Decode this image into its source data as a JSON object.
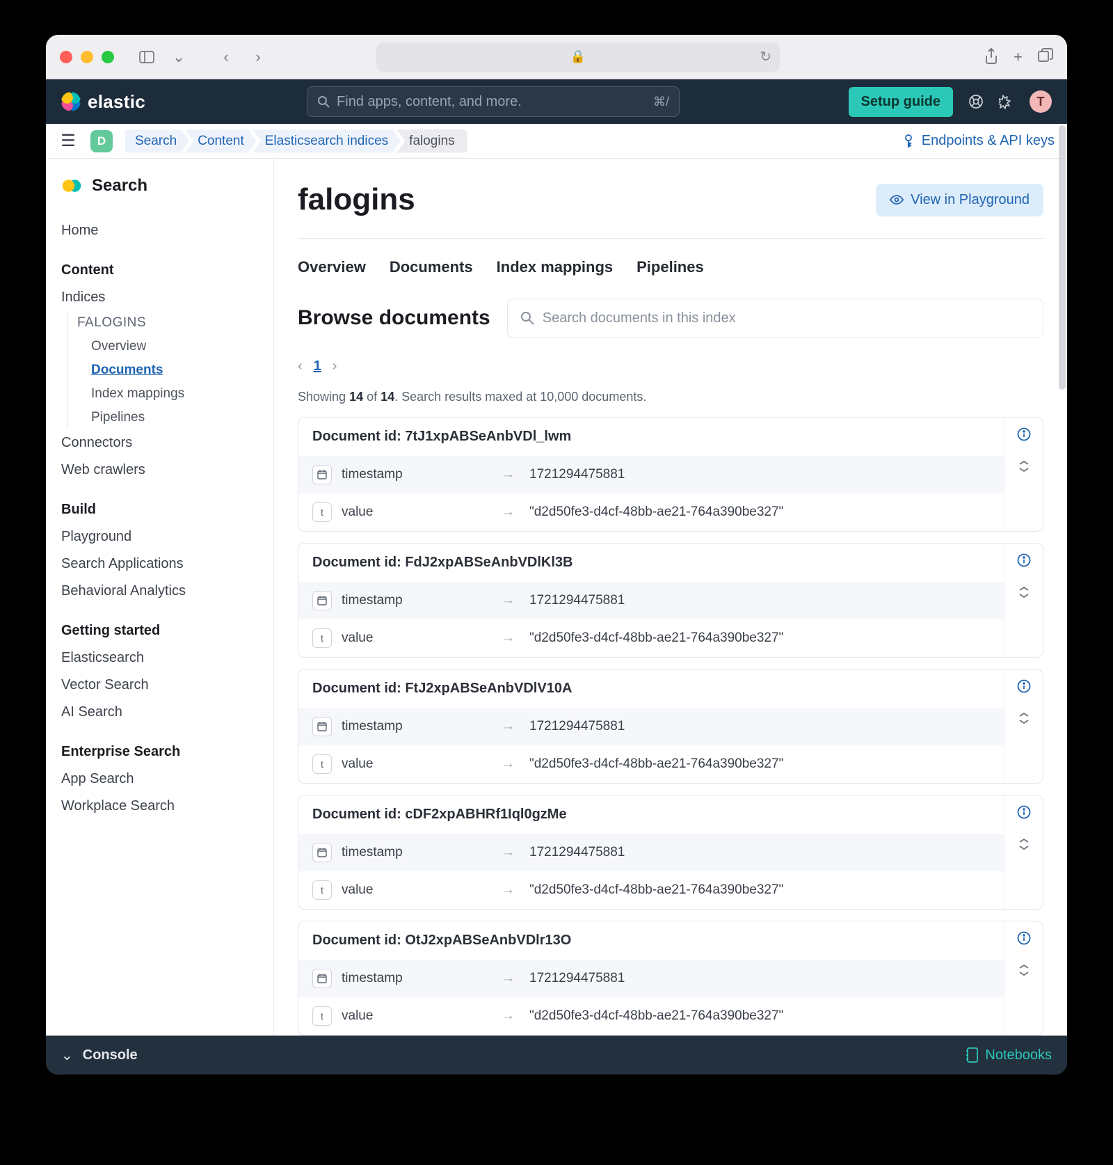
{
  "browser": {
    "lock": "🔒",
    "reload": "↻",
    "share": "⇧",
    "plus": "+",
    "tabs": "❐"
  },
  "header": {
    "brand": "elastic",
    "search_placeholder": "Find apps, content, and more.",
    "search_shortcut": "⌘/",
    "setup_guide": "Setup guide",
    "avatar_initial": "T"
  },
  "breadcrumb": {
    "space_initial": "D",
    "items": [
      "Search",
      "Content",
      "Elasticsearch indices",
      "falogins"
    ],
    "endpoints_link": "Endpoints & API keys"
  },
  "sidebar": {
    "section_title": "Search",
    "home": "Home",
    "content": {
      "head": "Content",
      "indices": "Indices",
      "current_index": "FALOGINS",
      "pages": [
        "Overview",
        "Documents",
        "Index mappings",
        "Pipelines"
      ],
      "selected": "Documents",
      "connectors": "Connectors",
      "web_crawlers": "Web crawlers"
    },
    "build": {
      "head": "Build",
      "items": [
        "Playground",
        "Search Applications",
        "Behavioral Analytics"
      ]
    },
    "getting_started": {
      "head": "Getting started",
      "items": [
        "Elasticsearch",
        "Vector Search",
        "AI Search"
      ]
    },
    "enterprise": {
      "head": "Enterprise Search",
      "items": [
        "App Search",
        "Workplace Search"
      ]
    }
  },
  "page": {
    "title": "falogins",
    "view_playground": "View in Playground",
    "tabs": [
      "Overview",
      "Documents",
      "Index mappings",
      "Pipelines"
    ],
    "browse_heading": "Browse documents",
    "doc_search_placeholder": "Search documents in this index",
    "pagination": {
      "current": "1"
    },
    "showing": {
      "prefix": "Showing ",
      "count": "14",
      "of_word": " of ",
      "total": "14",
      "suffix": ". Search results maxed at 10,000 documents."
    }
  },
  "documents": [
    {
      "id_label": "Document id: 7tJ1xpABSeAnbVDl_lwm",
      "fields": [
        {
          "type": "date",
          "name": "timestamp",
          "value": "1721294475881"
        },
        {
          "type": "text",
          "name": "value",
          "value": "\"d2d50fe3-d4cf-48bb-ae21-764a390be327\""
        }
      ]
    },
    {
      "id_label": "Document id: FdJ2xpABSeAnbVDlKl3B",
      "fields": [
        {
          "type": "date",
          "name": "timestamp",
          "value": "1721294475881"
        },
        {
          "type": "text",
          "name": "value",
          "value": "\"d2d50fe3-d4cf-48bb-ae21-764a390be327\""
        }
      ]
    },
    {
      "id_label": "Document id: FtJ2xpABSeAnbVDlV10A",
      "fields": [
        {
          "type": "date",
          "name": "timestamp",
          "value": "1721294475881"
        },
        {
          "type": "text",
          "name": "value",
          "value": "\"d2d50fe3-d4cf-48bb-ae21-764a390be327\""
        }
      ]
    },
    {
      "id_label": "Document id: cDF2xpABHRf1Iql0gzMe",
      "fields": [
        {
          "type": "date",
          "name": "timestamp",
          "value": "1721294475881"
        },
        {
          "type": "text",
          "name": "value",
          "value": "\"d2d50fe3-d4cf-48bb-ae21-764a390be327\""
        }
      ]
    },
    {
      "id_label": "Document id: OtJ2xpABSeAnbVDlr13O",
      "fields": [
        {
          "type": "date",
          "name": "timestamp",
          "value": "1721294475881"
        },
        {
          "type": "text",
          "name": "value",
          "value": "\"d2d50fe3-d4cf-48bb-ae21-764a390be327\""
        }
      ]
    }
  ],
  "console": {
    "title": "Console",
    "notebooks": "Notebooks"
  }
}
